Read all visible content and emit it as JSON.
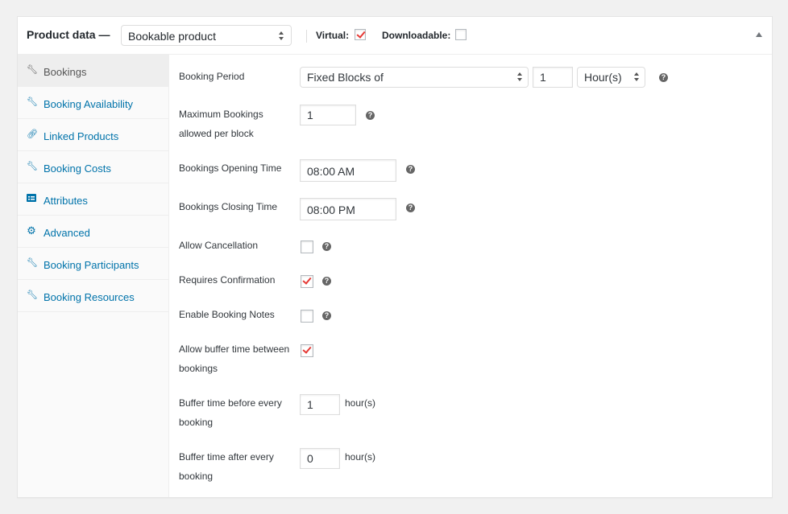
{
  "header": {
    "title": "Product data —",
    "product_type": "Bookable product",
    "virtual_label": "Virtual:",
    "virtual_checked": true,
    "downloadable_label": "Downloadable:",
    "downloadable_checked": false,
    "toggle_icon": "triangle-up-icon"
  },
  "sidebar": {
    "items": [
      {
        "label": "Bookings",
        "icon": "wrench-icon",
        "active": true
      },
      {
        "label": "Booking Availability",
        "icon": "wrench-icon"
      },
      {
        "label": "Linked Products",
        "icon": "link-icon"
      },
      {
        "label": "Booking Costs",
        "icon": "wrench-icon"
      },
      {
        "label": "Attributes",
        "icon": "list-card-icon"
      },
      {
        "label": "Advanced",
        "icon": "gear-icon"
      },
      {
        "label": "Booking Participants",
        "icon": "wrench-icon"
      },
      {
        "label": "Booking Resources",
        "icon": "wrench-icon"
      }
    ]
  },
  "fields": {
    "booking_period": {
      "label": "Booking Period",
      "type_value": "Fixed Blocks of",
      "count_value": "1",
      "unit_value": "Hour(s)"
    },
    "max_bookings": {
      "label_line1": "Maximum Bookings",
      "label_line2": "allowed per block",
      "value": "1"
    },
    "opening_time": {
      "label": "Bookings Opening Time",
      "value": "08:00 AM"
    },
    "closing_time": {
      "label": "Bookings Closing Time",
      "value": "08:00 PM"
    },
    "allow_cancellation": {
      "label": "Allow Cancellation",
      "checked": false
    },
    "requires_confirmation": {
      "label": "Requires Confirmation",
      "checked": true
    },
    "enable_notes": {
      "label": "Enable Booking Notes",
      "checked": false
    },
    "allow_buffer": {
      "label_line1": "Allow buffer time between",
      "label_line2": "bookings",
      "checked": true
    },
    "buffer_before": {
      "label_line1": "Buffer time before every",
      "label_line2": "booking",
      "value": "1",
      "unit": "hour(s)"
    },
    "buffer_after": {
      "label_line1": "Buffer time after every",
      "label_line2": "booking",
      "value": "0",
      "unit": "hour(s)"
    }
  },
  "help_glyph": "?"
}
